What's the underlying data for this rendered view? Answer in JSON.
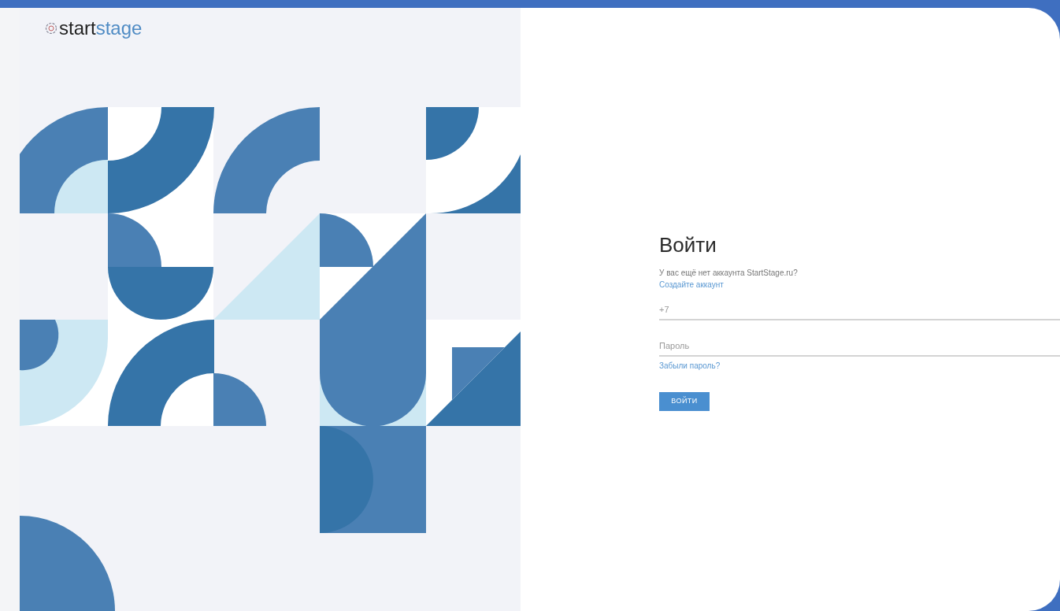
{
  "logo": {
    "part_1": "start",
    "part_2": "stage"
  },
  "login_form": {
    "title": "Войти",
    "prompt": "У вас ещё нет аккаунта StartStage.ru?",
    "create_account_link": "Создайте аккаунт",
    "phone_field": {
      "placeholder": "+7"
    },
    "password_field": {
      "placeholder": "Пароль"
    },
    "forgot_password_link": "Забыли пароль?",
    "submit_button": "ВОЙТИ"
  }
}
